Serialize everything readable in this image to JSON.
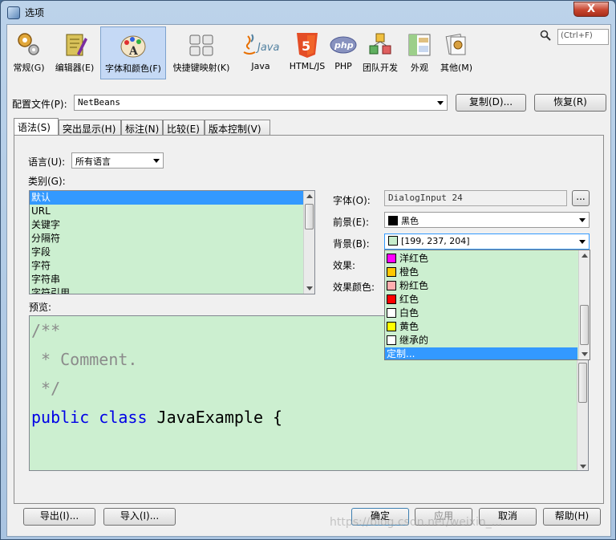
{
  "window": {
    "title": "选项",
    "close_glyph": "X"
  },
  "toolbar": {
    "items": [
      {
        "label": "常规(G)",
        "icon": "gears-icon"
      },
      {
        "label": "编辑器(E)",
        "icon": "editor-icon"
      },
      {
        "label": "字体和颜色(F)",
        "icon": "font-palette-icon",
        "active": true
      },
      {
        "label": "快捷键映射(K)",
        "icon": "keyboard-icon"
      },
      {
        "label": "Java",
        "icon": "java-icon"
      },
      {
        "label": "HTML/JS",
        "icon": "html5-icon"
      },
      {
        "label": "PHP",
        "icon": "php-icon"
      },
      {
        "label": "团队开发",
        "icon": "team-icon"
      },
      {
        "label": "外观",
        "icon": "appearance-icon"
      },
      {
        "label": "其他(M)",
        "icon": "misc-icon"
      }
    ],
    "search_placeholder": "(Ctrl+F)"
  },
  "profile": {
    "label": "配置文件(P):",
    "value": "NetBeans",
    "copy_button": "复制(D)...",
    "restore_button": "恢复(R)"
  },
  "tabs": [
    "语法(S)",
    "突出显示(H)",
    "标注(N)",
    "比较(E)",
    "版本控制(V)"
  ],
  "syntax": {
    "language_label": "语言(U):",
    "language_value": "所有语言",
    "category_label": "类别(G):",
    "categories": [
      "默认",
      "URL",
      "关键字",
      "分隔符",
      "字段",
      "字符",
      "字符串",
      "字符引用"
    ],
    "font_label": "字体(O):",
    "font_value": "DialogInput 24",
    "font_button": "...",
    "foreground_label": "前景(E):",
    "foreground_value": "黑色",
    "background_label": "背景(B):",
    "background_value": "[199, 237, 204]",
    "effect_label": "效果:",
    "effect_color_label": "效果颜色:",
    "preview_label": "预览:"
  },
  "dropdown_options": [
    {
      "label": "洋红色",
      "color": "#ff00ff"
    },
    {
      "label": "橙色",
      "color": "#ffc800"
    },
    {
      "label": "粉红色",
      "color": "#ffafaf"
    },
    {
      "label": "红色",
      "color": "#ff0000"
    },
    {
      "label": "白色",
      "color": "#ffffff"
    },
    {
      "label": "黄色",
      "color": "#ffff00"
    },
    {
      "label": "继承的",
      "color": "#ffffff"
    },
    {
      "label": "定制...",
      "color": null
    }
  ],
  "preview_code": [
    "/**",
    " * Comment.",
    " */",
    "public class JavaExample {"
  ],
  "preview_keywords": [
    "public",
    "class"
  ],
  "preview_code_rest": " JavaExample {",
  "footer": {
    "export": "导出(I)...",
    "import": "导入(I)...",
    "ok": "确定",
    "apply": "应用",
    "cancel": "取消",
    "help": "帮助(H)"
  },
  "watermark": "https://blog.csdn.net/weixin_...",
  "colors": {
    "background_rgb": "#c7edcc",
    "selection": "#3399ff",
    "keyword": "#0000e6",
    "comment": "#8b8b8b"
  }
}
